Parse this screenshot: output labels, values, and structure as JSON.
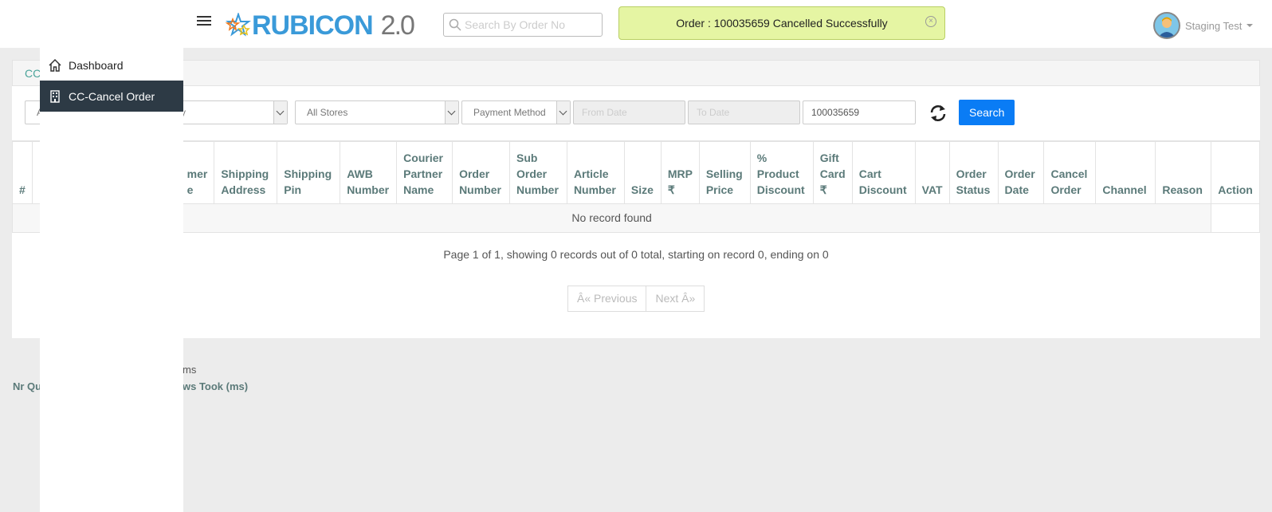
{
  "header": {
    "logo_text": "RUBICON",
    "logo_version": "2.0",
    "search_placeholder": "Search By Order No",
    "toast_message": "Order : 100035659 Cancelled Successfully",
    "user_name": "Staging Test"
  },
  "breadcrumb": "CC",
  "filters": {
    "first_select": "A",
    "second_select": "y",
    "store_select": "All Stores",
    "payment_select": "Payment Method",
    "from_date_placeholder": "From Date",
    "to_date_placeholder": "To Date",
    "order_no_value": "100035659",
    "search_label": "Search"
  },
  "table": {
    "headers": [
      "#",
      "",
      "mer e",
      "Shipping Address",
      "Shipping Pin",
      "AWB Number",
      "Courier Partner Name",
      "Order Number",
      "Sub Order Number",
      "Article Number",
      "Size",
      "MRP ₹",
      "Selling Price",
      "% Product Discount",
      "Gift Card ₹",
      "Cart Discount",
      "VAT",
      "Order Status",
      "Order Date",
      "Cancel Order",
      "Channel",
      "Reason",
      "Action"
    ],
    "empty_message": "No record found"
  },
  "pagination": {
    "info": "Page 1 of 1, showing 0 records out of 0 total, starting on record 0, ending on 0",
    "previous": "Â« Previous",
    "next": "Next Â»"
  },
  "footer": {
    "line1": "ms",
    "line2_left": "Nr Qu",
    "line2_right": "ws Took (ms)"
  },
  "sidebar": {
    "items": [
      {
        "label": "Dashboard",
        "icon": "home-icon"
      },
      {
        "label": "CC-Cancel Order",
        "icon": "building-icon"
      }
    ]
  },
  "colors": {
    "primary_button": "#0a7cf5",
    "sidebar_active": "#2d3a45",
    "toast_bg": "#e5f5a3",
    "header_text": "#5b7a79",
    "logo_blue": "#3a9ad9"
  }
}
